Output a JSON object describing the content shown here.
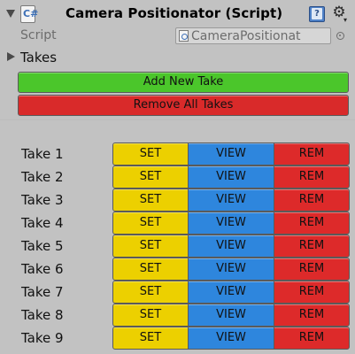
{
  "header": {
    "title": "Camera Positionator (Script)",
    "script_icon_glyph": "C#",
    "help_icon_glyph": "?",
    "gear_icon_glyph": "⚙",
    "gear_caret_glyph": "▾"
  },
  "script_row": {
    "label": "Script",
    "value": "CameraPositionat"
  },
  "takes_foldout": {
    "label": "Takes",
    "expanded": false
  },
  "buttons": {
    "add_new_take": "Add New Take",
    "remove_all_takes": "Remove All Takes"
  },
  "colors": {
    "add": "#4bc62b",
    "remove": "#d92a2a",
    "set": "#ecd000",
    "view": "#2e86dd",
    "rem": "#dd2a2a",
    "background": "#c2c2c2"
  },
  "take_actions": {
    "set": "SET",
    "view": "VIEW",
    "rem": "REM"
  },
  "takes": [
    {
      "label": "Take 1"
    },
    {
      "label": "Take 2"
    },
    {
      "label": "Take 3"
    },
    {
      "label": "Take 4"
    },
    {
      "label": "Take 5"
    },
    {
      "label": "Take 6"
    },
    {
      "label": "Take 7"
    },
    {
      "label": "Take 8"
    },
    {
      "label": "Take 9"
    }
  ]
}
